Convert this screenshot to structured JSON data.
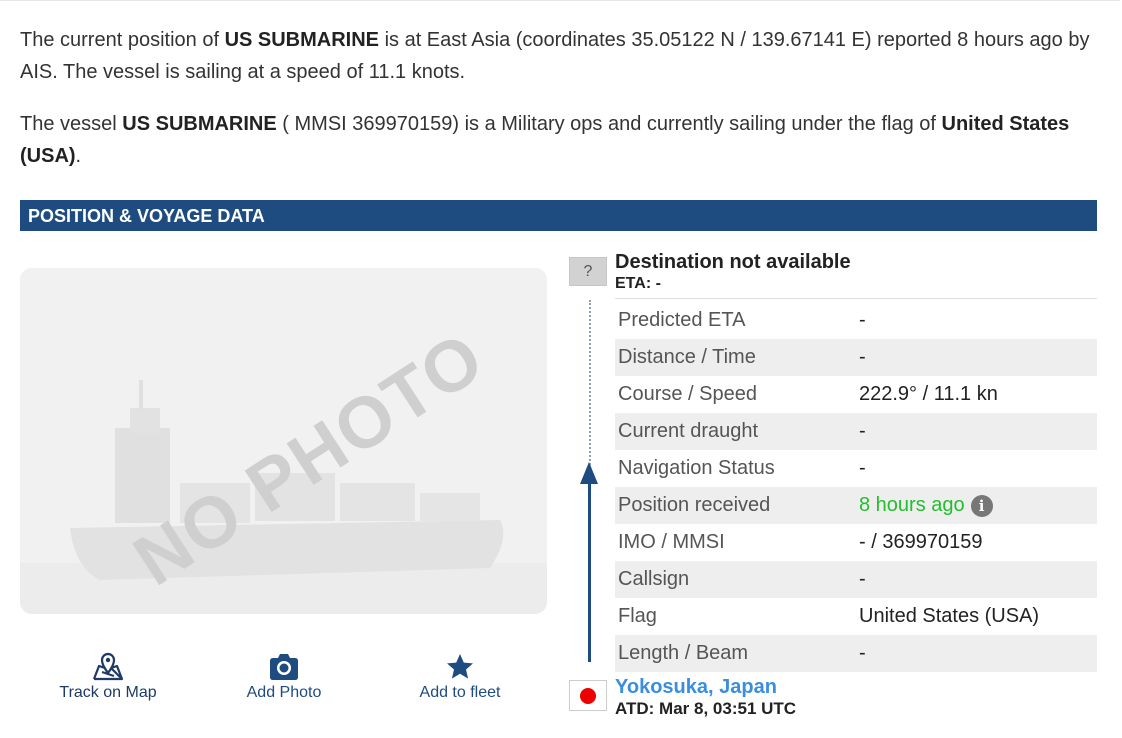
{
  "intro": {
    "p1": {
      "a": "The current position of ",
      "vessel": "US SUBMARINE",
      "b": " is at East Asia (coordinates 35.05122 N / 139.67141 E) reported 8 hours ago by AIS. The vessel is sailing at a speed of 11.1 knots."
    },
    "p2": {
      "a": "The vessel ",
      "vessel": "US SUBMARINE",
      "b": " ( MMSI 369970159) is a Military ops and currently sailing under the flag of ",
      "flag": "United States (USA)",
      "c": "."
    }
  },
  "section": {
    "title": "POSITION & VOYAGE DATA"
  },
  "photo": {
    "overlay": "NO PHOTO"
  },
  "actions": {
    "track": {
      "label": "Track on Map",
      "icon": "map-pin-icon"
    },
    "photo": {
      "label": "Add Photo",
      "icon": "camera-icon"
    },
    "fleet": {
      "label": "Add to fleet",
      "icon": "star-icon"
    }
  },
  "destination": {
    "flag_placeholder": "?",
    "title": "Destination not available",
    "eta": "ETA: -"
  },
  "rows": [
    {
      "key": "Predicted ETA",
      "value": "-"
    },
    {
      "key": "Distance / Time",
      "value": "-"
    },
    {
      "key": "Course / Speed",
      "value": "222.9° / 11.1 kn"
    },
    {
      "key": "Current draught",
      "value": "-"
    },
    {
      "key": "Navigation Status",
      "value": "-"
    },
    {
      "key": "Position received",
      "value": "8 hours ago"
    },
    {
      "key": "IMO / MMSI",
      "value": "- / 369970159"
    },
    {
      "key": "Callsign",
      "value": "-"
    },
    {
      "key": "Flag",
      "value": "United States (USA)"
    },
    {
      "key": "Length / Beam",
      "value": "-"
    }
  ],
  "departure": {
    "port": "Yokosuka, Japan",
    "atd": "ATD: Mar 8, 03:51 UTC"
  },
  "colors": {
    "header_bg": "#1f4c80",
    "link": "#3a8ee0",
    "fresh": "#21c02c"
  }
}
